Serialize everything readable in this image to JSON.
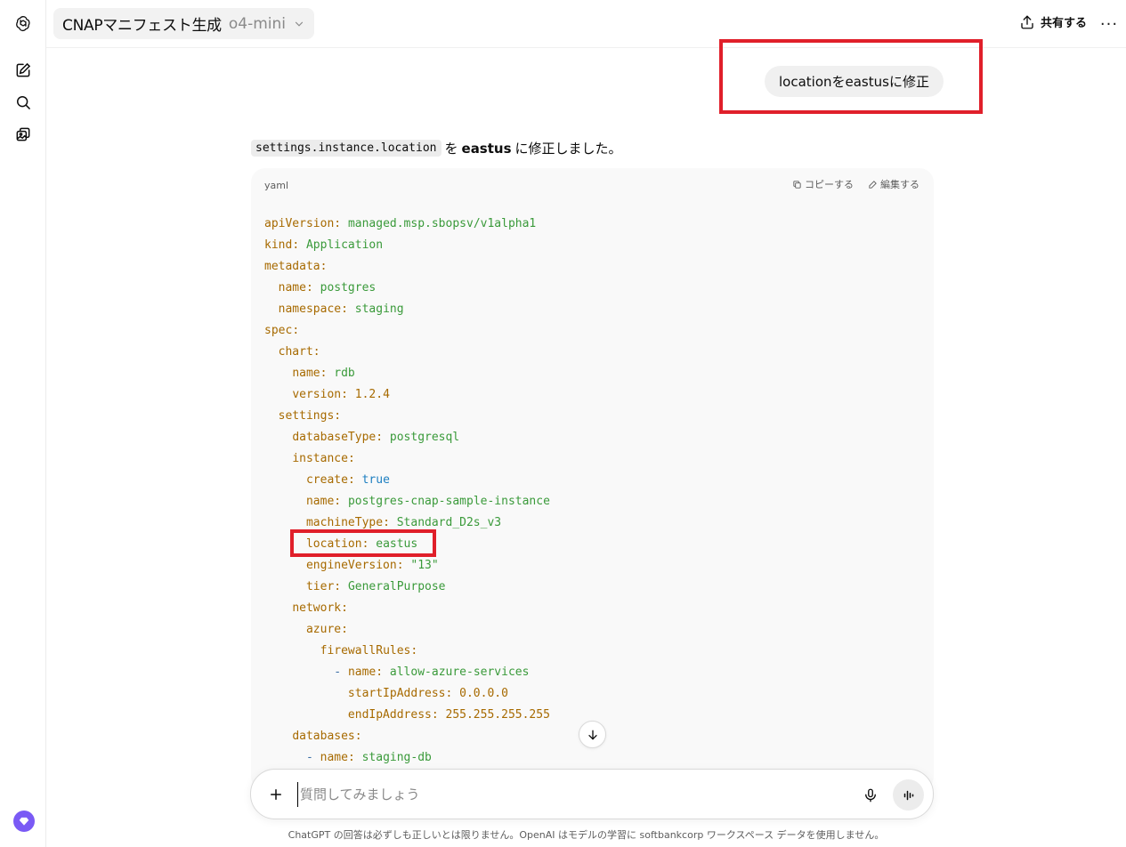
{
  "header": {
    "model_title": "CNAPマニフェスト生成",
    "model_name": "o4-mini",
    "share_label": "共有する",
    "more_label": "···"
  },
  "user_message": "locationをeastusに修正",
  "assistant": {
    "inline_code": "settings.instance.location",
    "text_before": "を",
    "bold": "eastus",
    "text_after": "に修正しました。"
  },
  "code_block": {
    "language": "yaml",
    "copy_label": "コピーする",
    "edit_label": "編集する",
    "lines": [
      {
        "indent": "",
        "key": "apiVersion",
        "value": "managed.msp.sbopsv/v1alpha1",
        "vtype": "str"
      },
      {
        "indent": "",
        "key": "kind",
        "value": "Application",
        "vtype": "str"
      },
      {
        "indent": "",
        "key": "metadata",
        "value": "",
        "vtype": "none"
      },
      {
        "indent": "  ",
        "key": "name",
        "value": "postgres",
        "vtype": "str"
      },
      {
        "indent": "  ",
        "key": "namespace",
        "value": "staging",
        "vtype": "str"
      },
      {
        "indent": "",
        "key": "spec",
        "value": "",
        "vtype": "none"
      },
      {
        "indent": "  ",
        "key": "chart",
        "value": "",
        "vtype": "none"
      },
      {
        "indent": "    ",
        "key": "name",
        "value": "rdb",
        "vtype": "str"
      },
      {
        "indent": "    ",
        "key": "version",
        "value": "1.2.4",
        "vtype": "num"
      },
      {
        "indent": "  ",
        "key": "settings",
        "value": "",
        "vtype": "none"
      },
      {
        "indent": "    ",
        "key": "databaseType",
        "value": "postgresql",
        "vtype": "str"
      },
      {
        "indent": "    ",
        "key": "instance",
        "value": "",
        "vtype": "none"
      },
      {
        "indent": "      ",
        "key": "create",
        "value": "true",
        "vtype": "bool"
      },
      {
        "indent": "      ",
        "key": "name",
        "value": "postgres-cnap-sample-instance",
        "vtype": "str"
      },
      {
        "indent": "      ",
        "key": "machineType",
        "value": "Standard_D2s_v3",
        "vtype": "str"
      },
      {
        "indent": "      ",
        "key": "location",
        "value": "eastus",
        "vtype": "str"
      },
      {
        "indent": "      ",
        "key": "engineVersion",
        "value": "\"13\"",
        "vtype": "str"
      },
      {
        "indent": "      ",
        "key": "tier",
        "value": "GeneralPurpose",
        "vtype": "str"
      },
      {
        "indent": "    ",
        "key": "network",
        "value": "",
        "vtype": "none"
      },
      {
        "indent": "      ",
        "key": "azure",
        "value": "",
        "vtype": "none"
      },
      {
        "indent": "        ",
        "key": "firewallRules",
        "value": "",
        "vtype": "none"
      },
      {
        "indent": "          - ",
        "key": "name",
        "value": "allow-azure-services",
        "vtype": "str"
      },
      {
        "indent": "            ",
        "key": "startIpAddress",
        "value": "0.0.0.0",
        "vtype": "num"
      },
      {
        "indent": "            ",
        "key": "endIpAddress",
        "value": "255.255.255.255",
        "vtype": "num"
      },
      {
        "indent": "    ",
        "key": "databases",
        "value": "",
        "vtype": "none"
      },
      {
        "indent": "      - ",
        "key": "name",
        "value": "staging-db",
        "vtype": "str"
      }
    ]
  },
  "composer": {
    "placeholder": "質問してみましょう"
  },
  "footer_note": "ChatGPT の回答は必ずしも正しいとは限りません。OpenAI はモデルの学習に softbankcorp ワークスペース データを使用しません。",
  "colors": {
    "highlight": "#e01f2a",
    "key": "#a76a00",
    "string": "#3a9a3a",
    "bool": "#1d7fc1"
  }
}
